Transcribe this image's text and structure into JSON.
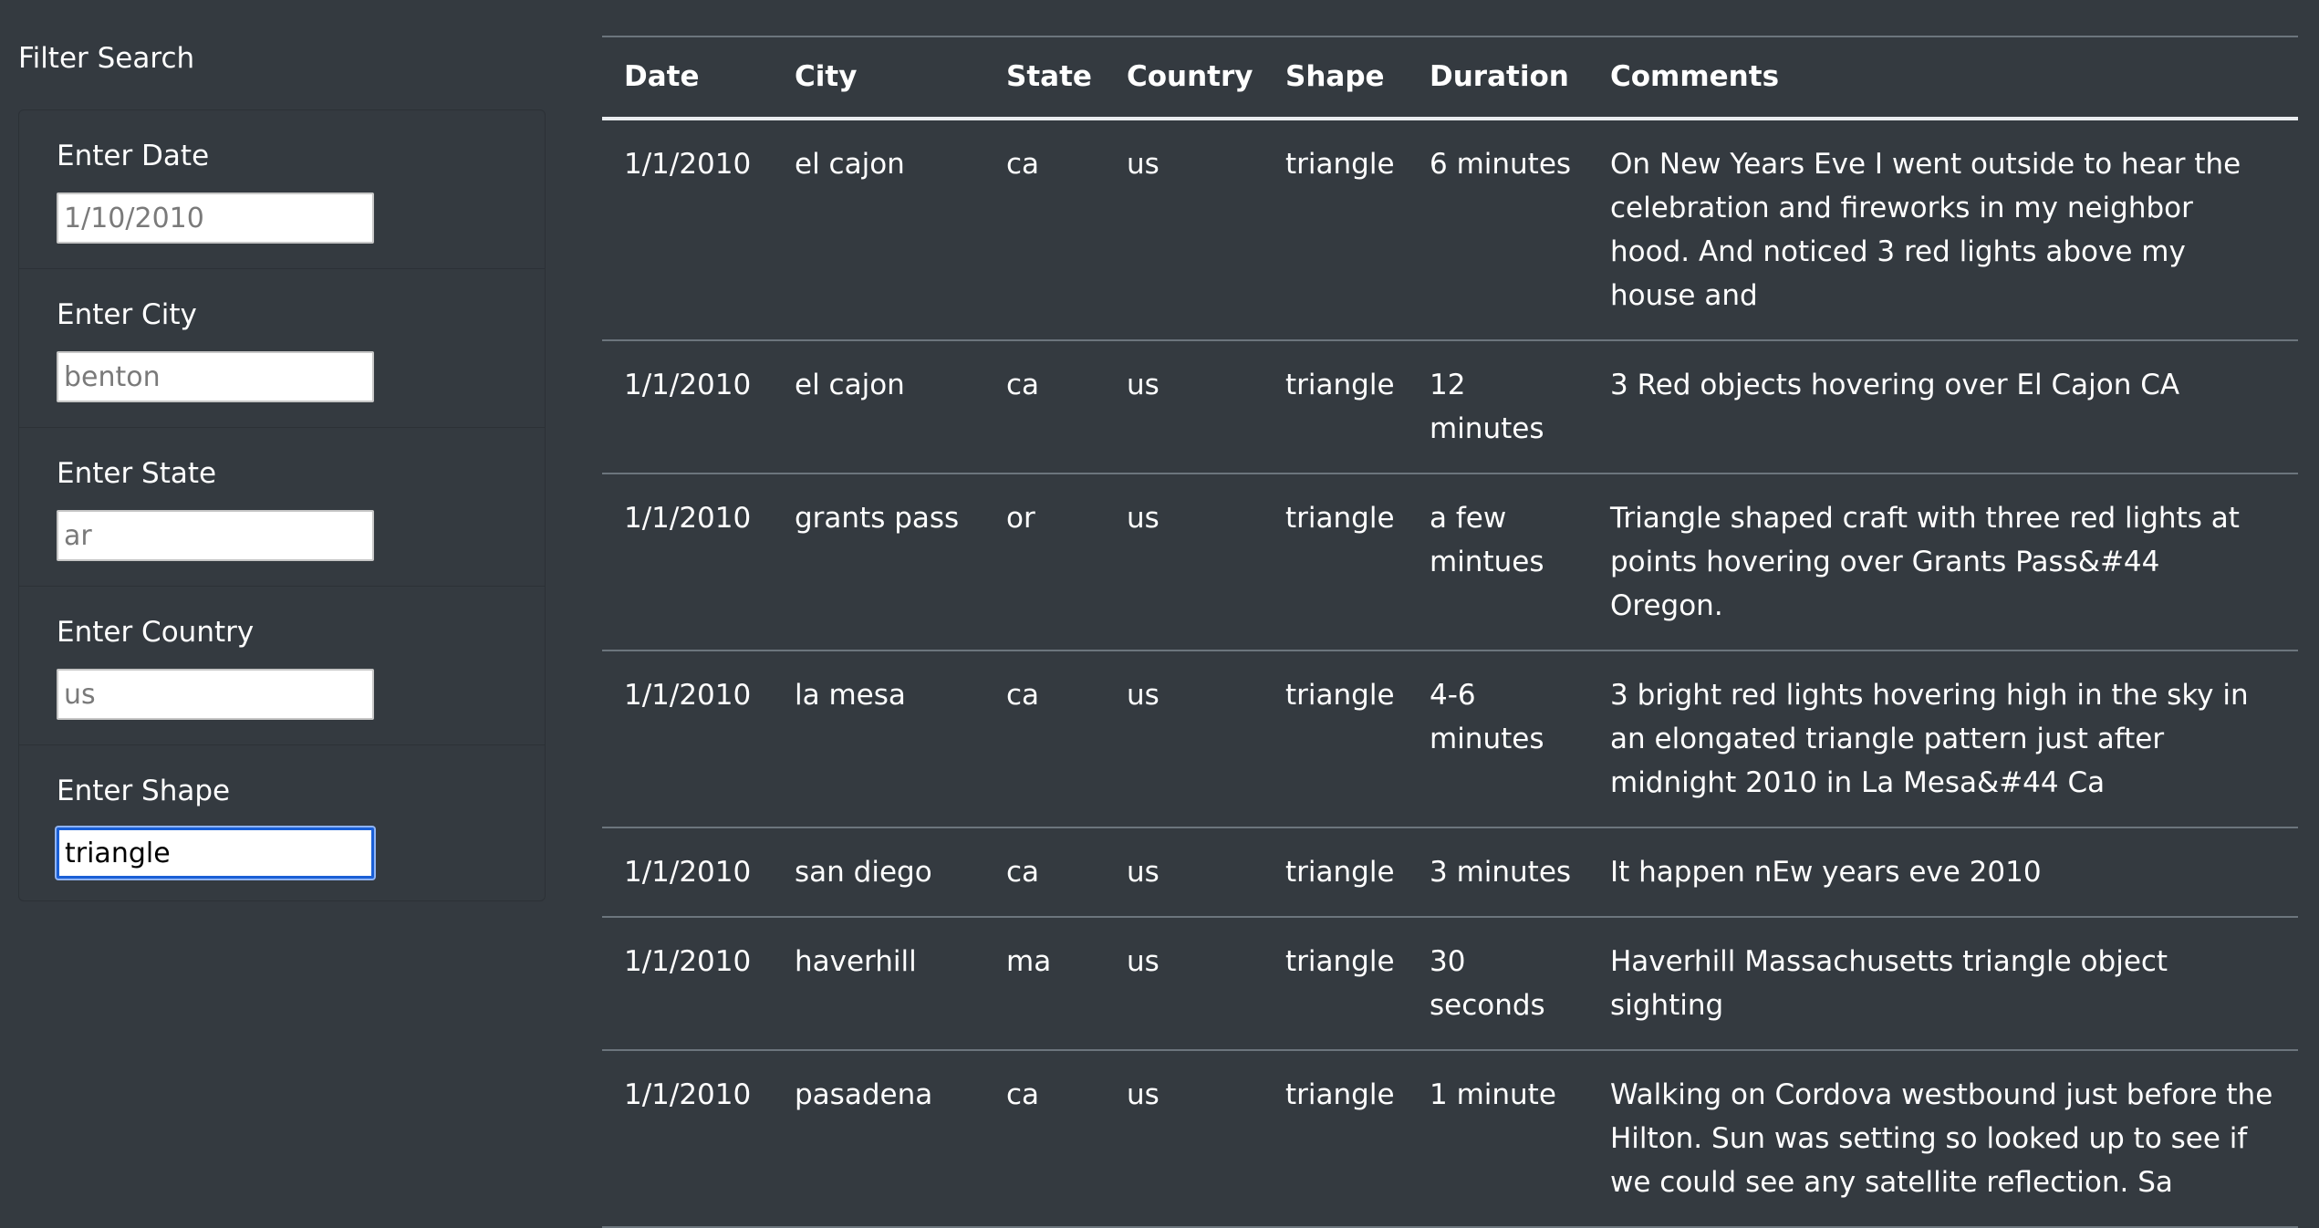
{
  "sidebar": {
    "title": "Filter Search",
    "filters": [
      {
        "label": "Enter Date",
        "placeholder": "1/10/2010",
        "value": ""
      },
      {
        "label": "Enter City",
        "placeholder": "benton",
        "value": ""
      },
      {
        "label": "Enter State",
        "placeholder": "ar",
        "value": ""
      },
      {
        "label": "Enter Country",
        "placeholder": "us",
        "value": ""
      },
      {
        "label": "Enter Shape",
        "placeholder": "",
        "value": "triangle"
      }
    ]
  },
  "table": {
    "headers": [
      "Date",
      "City",
      "State",
      "Country",
      "Shape",
      "Duration",
      "Comments"
    ],
    "rows": [
      [
        "1/1/2010",
        "el cajon",
        "ca",
        "us",
        "triangle",
        "6 minutes",
        "On New Years Eve I went outside to hear the celebration and fireworks in my neighbor hood. And noticed 3 red lights above my house and"
      ],
      [
        "1/1/2010",
        "el cajon",
        "ca",
        "us",
        "triangle",
        "12 minutes",
        "3 Red objects hovering over El Cajon CA"
      ],
      [
        "1/1/2010",
        "grants pass",
        "or",
        "us",
        "triangle",
        "a few mintues",
        "Triangle shaped craft with three red lights at points hovering over Grants Pass&#44 Oregon."
      ],
      [
        "1/1/2010",
        "la mesa",
        "ca",
        "us",
        "triangle",
        "4-6 minutes",
        "3 bright red lights hovering high in the sky in an elongated triangle pattern just after midnight 2010 in La Mesa&#44 Ca"
      ],
      [
        "1/1/2010",
        "san diego",
        "ca",
        "us",
        "triangle",
        "3 minutes",
        "It happen nEw years eve 2010"
      ],
      [
        "1/1/2010",
        "haverhill",
        "ma",
        "us",
        "triangle",
        "30 seconds",
        "Haverhill Massachusetts triangle object sighting"
      ],
      [
        "1/1/2010",
        "pasadena",
        "ca",
        "us",
        "triangle",
        "1 minute",
        "Walking on Cordova westbound just before the Hilton. Sun was setting so looked up to see if we could see any satellite reflection. Sa"
      ]
    ]
  }
}
